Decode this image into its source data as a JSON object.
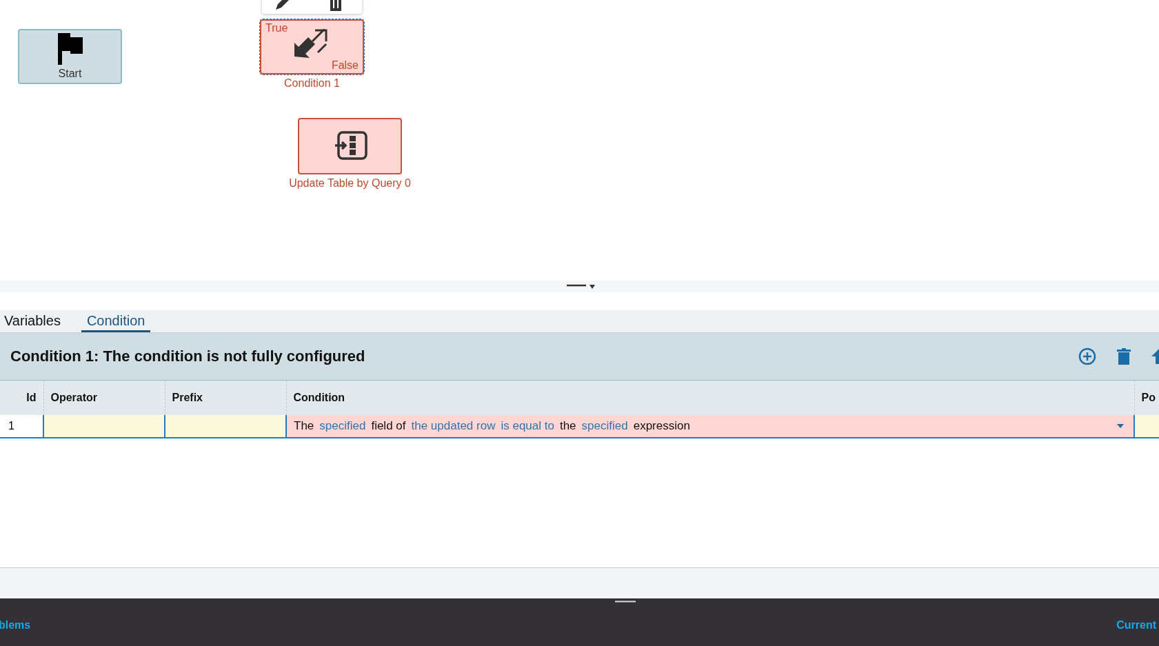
{
  "canvas": {
    "nodes": [
      {
        "kind": "start",
        "label": "Start",
        "selected": false,
        "error": false
      },
      {
        "kind": "condition",
        "label": "Condition 1",
        "true_label": "True",
        "false_label": "False",
        "selected": true,
        "error": true
      },
      {
        "kind": "update",
        "label": "Update Table by Query 0",
        "selected": false,
        "error": true
      }
    ]
  },
  "tabs": [
    {
      "label": "Variables",
      "selected": false
    },
    {
      "label": "Condition",
      "selected": true
    }
  ],
  "panel": {
    "title": "Condition 1: The condition is not fully configured"
  },
  "table": {
    "columns": [
      "Id",
      "Operator",
      "Prefix",
      "Condition",
      "Po"
    ],
    "rows": [
      {
        "id": "1",
        "error": true,
        "condition": [
          {
            "text": "The",
            "kind": "plain"
          },
          {
            "text": "specified",
            "kind": "link"
          },
          {
            "text": "field of",
            "kind": "plain"
          },
          {
            "text": "the updated row",
            "kind": "link"
          },
          {
            "text": "is equal to",
            "kind": "link"
          },
          {
            "text": "the",
            "kind": "plain"
          },
          {
            "text": "specified",
            "kind": "link"
          },
          {
            "text": "expression",
            "kind": "plain"
          }
        ]
      }
    ]
  },
  "status_bar": {
    "left": "blems",
    "right": "Current"
  }
}
